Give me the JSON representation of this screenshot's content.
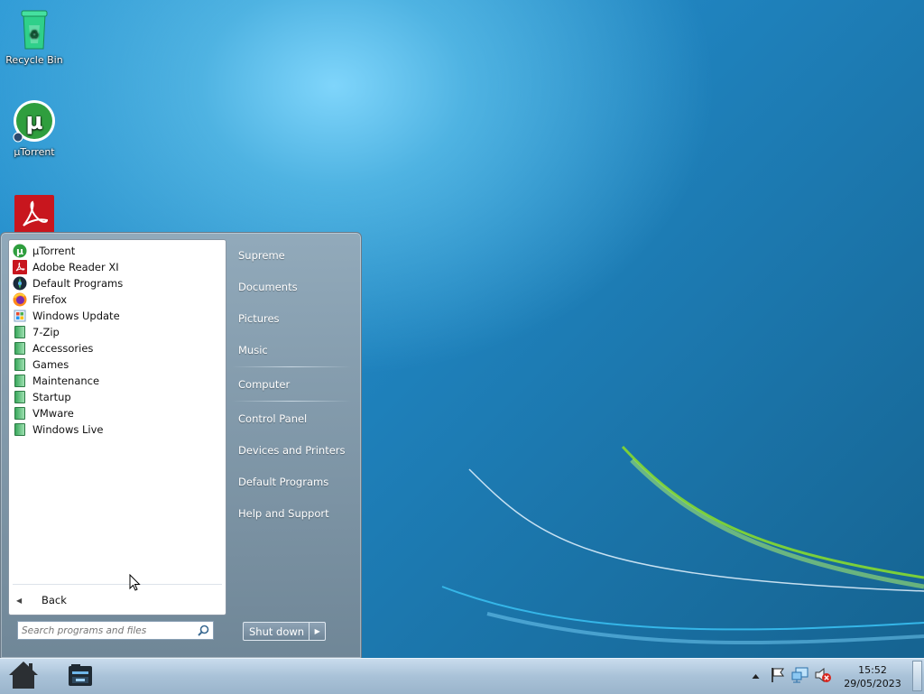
{
  "desktop": {
    "icons": [
      {
        "label": "Recycle Bin",
        "icon": "recycle-bin-icon"
      },
      {
        "label": "µTorrent",
        "icon": "utorrent-icon"
      },
      {
        "label": "",
        "icon": "adobe-reader-icon"
      }
    ]
  },
  "start_menu": {
    "programs": [
      {
        "label": "µTorrent",
        "icon": "utorrent-icon"
      },
      {
        "label": "Adobe Reader XI",
        "icon": "adobe-reader-icon"
      },
      {
        "label": "Default Programs",
        "icon": "default-programs-icon"
      },
      {
        "label": "Firefox",
        "icon": "firefox-icon"
      },
      {
        "label": "Windows Update",
        "icon": "windows-update-icon"
      },
      {
        "label": "7-Zip",
        "icon": "folder-icon"
      },
      {
        "label": "Accessories",
        "icon": "folder-icon"
      },
      {
        "label": "Games",
        "icon": "folder-icon"
      },
      {
        "label": "Maintenance",
        "icon": "folder-icon"
      },
      {
        "label": "Startup",
        "icon": "folder-icon"
      },
      {
        "label": "VMware",
        "icon": "folder-icon"
      },
      {
        "label": "Windows Live",
        "icon": "folder-icon"
      }
    ],
    "back_label": "Back",
    "search": {
      "placeholder": "Search programs and files",
      "value": ""
    },
    "right_items": [
      {
        "label": "Supreme"
      },
      {
        "label": "Documents"
      },
      {
        "label": "Pictures"
      },
      {
        "label": "Music"
      },
      {
        "label": "Computer"
      },
      {
        "label": "Control Panel"
      },
      {
        "label": "Devices and Printers"
      },
      {
        "label": "Default Programs"
      },
      {
        "label": "Help and Support"
      }
    ],
    "shutdown_label": "Shut down"
  },
  "taskbar": {
    "start_button": "start-home-icon",
    "pinned": [
      "file-explorer-icon"
    ],
    "tray_icons": [
      "show-hidden-icons-arrow",
      "action-center-flag-icon",
      "network-icon",
      "volume-muted-icon"
    ],
    "clock_time": "15:52",
    "clock_date": "29/05/2023"
  },
  "colors": {
    "desktop_bg": "#1f82bd",
    "taskbar_bg": "#a9c2d8",
    "start_menu_right": "#8a9fb0"
  }
}
